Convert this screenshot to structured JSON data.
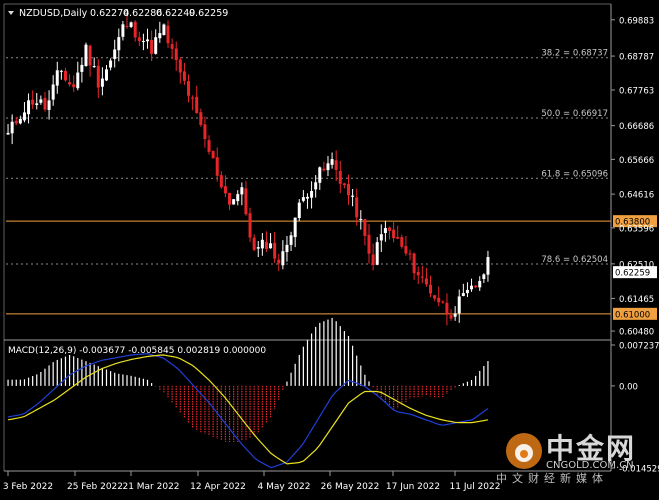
{
  "header": {
    "symbol": "NZDUSD,Daily",
    "open": "0.62274",
    "high": "0.62286",
    "low": "0.62249",
    "close": "0.62259"
  },
  "price_axis": [
    "0.69883",
    "0.68787",
    "0.67763",
    "0.66686",
    "0.65666",
    "0.64616",
    "0.63596",
    "0.62510",
    "0.61465",
    "0.60480"
  ],
  "current_price_label": "0.62259",
  "levels": [
    {
      "label": "38.2 = 0.68737",
      "price": 0.68737,
      "style": "dotted",
      "color": "#8c8c8c"
    },
    {
      "label": "50.0 = 0.66917",
      "price": 0.66917,
      "style": "dotted",
      "color": "#8c8c8c"
    },
    {
      "label": "61.8 = 0.65096",
      "price": 0.65096,
      "style": "dotted",
      "color": "#8c8c8c"
    },
    {
      "label": "78.6 = 0.62504",
      "price": 0.62504,
      "style": "dotted",
      "color": "#8c8c8c"
    },
    {
      "label": "0.63800",
      "price": 0.638,
      "style": "solid",
      "color": "#f0a040"
    },
    {
      "label": "0.61000",
      "price": 0.61,
      "style": "solid",
      "color": "#f0a040"
    }
  ],
  "date_axis": [
    "3 Feb 2022",
    "25 Feb 2022",
    "21 Mar 2022",
    "12 Apr 2022",
    "4 May 2022",
    "26 May 2022",
    "17 Jun 2022",
    "11 Jul 2022"
  ],
  "macd": {
    "header": "MACD(12,26,9) -0.003677 -0.005845 0.002819 0.000000",
    "axis": [
      "0.007237",
      "0.00",
      "-0.014529"
    ]
  },
  "colors": {
    "background": "#000000",
    "bull_candle": "#ffffff",
    "bear_candle": "#e8262a",
    "grid": "#555555",
    "macd_main": "#1f3fd8",
    "macd_signal": "#e8e020",
    "hist_pos": "#ffffff",
    "hist_neg": "#e8262a",
    "support_resistance": "#f0a040"
  },
  "watermark": {
    "brand": "中金网",
    "url": "CNGOLD.COM.CN",
    "tagline": "中文财经新媒体"
  },
  "chart_data": {
    "type": "candlestick",
    "x_range": [
      "2022-01-31",
      "2022-07-22"
    ],
    "ylim": [
      0.603,
      0.703
    ],
    "anchors": [
      [
        0.664,
        0.669,
        0.66
      ],
      [
        0.671,
        0.676,
        0.666
      ],
      [
        0.675,
        0.681,
        0.671
      ],
      [
        0.672,
        0.678,
        0.668
      ],
      [
        0.684,
        0.688,
        0.68
      ],
      [
        0.678,
        0.685,
        0.674
      ],
      [
        0.69,
        0.694,
        0.686
      ],
      [
        0.68,
        0.687,
        0.676
      ],
      [
        0.687,
        0.692,
        0.683
      ],
      [
        0.698,
        0.701,
        0.693
      ],
      [
        0.695,
        0.7,
        0.689
      ],
      [
        0.69,
        0.697,
        0.686
      ],
      [
        0.696,
        0.704,
        0.691
      ],
      [
        0.685,
        0.693,
        0.68
      ],
      [
        0.676,
        0.683,
        0.671
      ],
      [
        0.664,
        0.672,
        0.66
      ],
      [
        0.654,
        0.661,
        0.647
      ],
      [
        0.644,
        0.65,
        0.638
      ],
      [
        0.647,
        0.657,
        0.643
      ],
      [
        0.628,
        0.636,
        0.622
      ],
      [
        0.632,
        0.638,
        0.626
      ],
      [
        0.625,
        0.632,
        0.62
      ],
      [
        0.638,
        0.642,
        0.633
      ],
      [
        0.647,
        0.651,
        0.642
      ],
      [
        0.652,
        0.656,
        0.648
      ],
      [
        0.656,
        0.659,
        0.65
      ],
      [
        0.648,
        0.655,
        0.643
      ],
      [
        0.64,
        0.646,
        0.635
      ],
      [
        0.625,
        0.633,
        0.62
      ],
      [
        0.636,
        0.639,
        0.63
      ],
      [
        0.632,
        0.637,
        0.628
      ],
      [
        0.626,
        0.63,
        0.622
      ],
      [
        0.62,
        0.626,
        0.616
      ],
      [
        0.615,
        0.62,
        0.609
      ],
      [
        0.61,
        0.616,
        0.606
      ],
      [
        0.614,
        0.619,
        0.608
      ],
      [
        0.618,
        0.623,
        0.613
      ],
      [
        0.625,
        0.627,
        0.62
      ]
    ],
    "macd_main_anchors": [
      -0.0055,
      -0.005,
      -0.003,
      -0.0005,
      0.002,
      0.0035,
      0.0045,
      0.005,
      0.0055,
      0.0057,
      0.005,
      0.003,
      0.0,
      -0.003,
      -0.0065,
      -0.01,
      -0.013,
      -0.0145,
      -0.0135,
      -0.0105,
      -0.006,
      -0.0015,
      0.001,
      0.0,
      -0.002,
      -0.0045,
      -0.005,
      -0.006,
      -0.007,
      -0.0065,
      -0.006,
      -0.004
    ],
    "macd_signal_anchors": [
      -0.006,
      -0.0055,
      -0.004,
      -0.0025,
      -0.0005,
      0.0015,
      0.003,
      0.004,
      0.0047,
      0.0052,
      0.0055,
      0.005,
      0.0035,
      0.001,
      -0.002,
      -0.0055,
      -0.009,
      -0.012,
      -0.0138,
      -0.0135,
      -0.011,
      -0.007,
      -0.003,
      -0.001,
      -0.001,
      -0.0025,
      -0.004,
      -0.0052,
      -0.006,
      -0.0065,
      -0.0065,
      -0.006
    ]
  }
}
